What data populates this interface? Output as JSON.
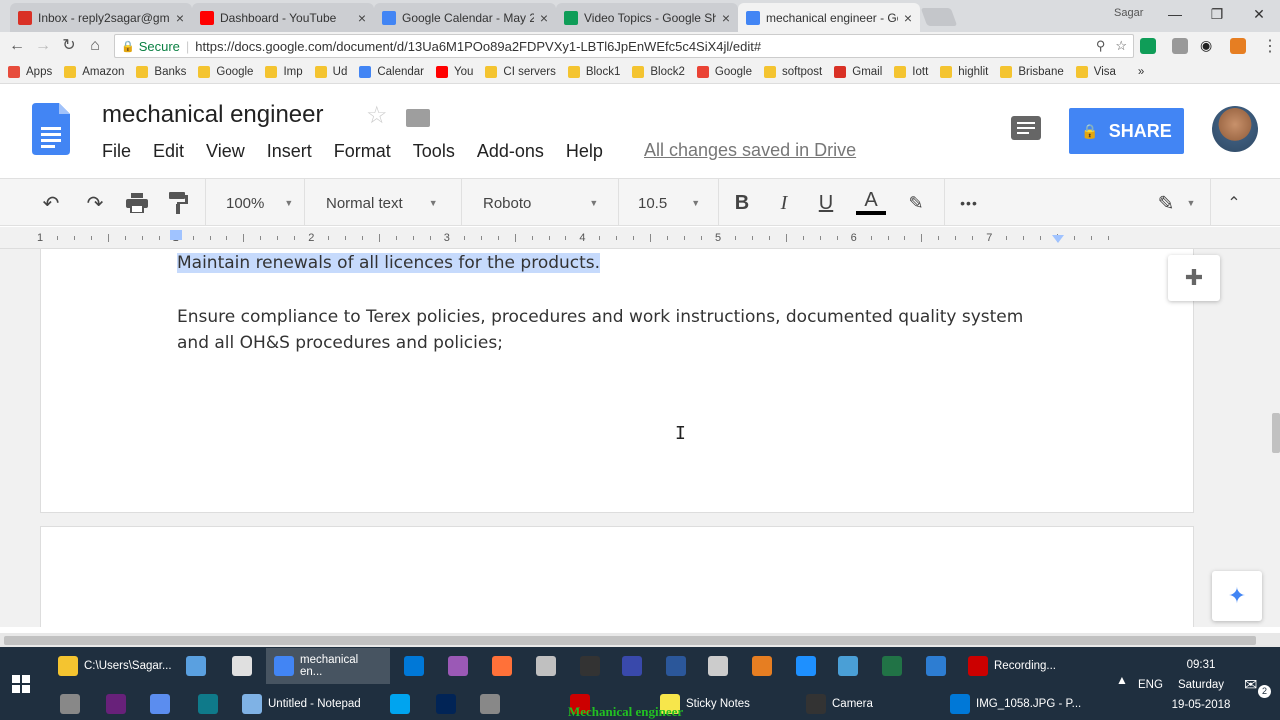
{
  "browser": {
    "tabs": [
      {
        "title": "Inbox - reply2sagar@gm",
        "icon": "gmail-icon",
        "color": "#d93025"
      },
      {
        "title": "Dashboard - YouTube",
        "icon": "youtube-icon",
        "color": "#ff0000"
      },
      {
        "title": "Google Calendar - May 2",
        "icon": "calendar-icon",
        "color": "#4285f4"
      },
      {
        "title": "Video Topics - Google Sh",
        "icon": "sheets-icon",
        "color": "#0f9d58"
      },
      {
        "title": "mechanical engineer - Go",
        "icon": "docs-icon",
        "color": "#4285f4"
      }
    ],
    "user": "Sagar",
    "secure_label": "Secure",
    "url": "https://docs.google.com/document/d/13Ua6M1POo89a2FDPVXy1-LBTl6JpEnWEfc5c4SiX4jl/edit#",
    "bookmarks": [
      {
        "label": "Apps",
        "color": "#e74c3c"
      },
      {
        "label": "Amazon",
        "color": "#f4c430"
      },
      {
        "label": "Banks",
        "color": "#f4c430"
      },
      {
        "label": "Google",
        "color": "#f4c430"
      },
      {
        "label": "Imp",
        "color": "#f4c430"
      },
      {
        "label": "Ud",
        "color": "#f4c430"
      },
      {
        "label": "Calendar",
        "color": "#4285f4"
      },
      {
        "label": "You",
        "color": "#ff0000"
      },
      {
        "label": "CI servers",
        "color": "#f4c430"
      },
      {
        "label": "Block1",
        "color": "#f4c430"
      },
      {
        "label": "Block2",
        "color": "#f4c430"
      },
      {
        "label": "Google",
        "color": "#ea4335"
      },
      {
        "label": "softpost",
        "color": "#f4c430"
      },
      {
        "label": "Gmail",
        "color": "#d93025"
      },
      {
        "label": "Iott",
        "color": "#f4c430"
      },
      {
        "label": "highlit",
        "color": "#f4c430"
      },
      {
        "label": "Brisbane",
        "color": "#f4c430"
      },
      {
        "label": "Visa",
        "color": "#f4c430"
      }
    ]
  },
  "doc": {
    "title": "mechanical engineer",
    "menu": [
      "File",
      "Edit",
      "View",
      "Insert",
      "Format",
      "Tools",
      "Add-ons",
      "Help"
    ],
    "save_status": "All changes saved in Drive",
    "share_label": "SHARE",
    "accent": "#4285f4"
  },
  "toolbar": {
    "zoom": "100%",
    "style": "Normal text",
    "font": "Roboto",
    "size": "10.5",
    "more": "•••"
  },
  "ruler": {
    "numbers": [
      "1",
      "1",
      "2",
      "3",
      "4",
      "5",
      "6",
      "7"
    ]
  },
  "content": {
    "line1": "Maintain renewals of all licences for the products.",
    "line2": "Ensure compliance to Terex policies, procedures and work instructions, documented quality system",
    "line3": "and all OH&S procedures and policies;"
  },
  "taskbar": {
    "row1": [
      {
        "label": "C:\\Users\\Sagar...",
        "color": "#f4c430"
      },
      {
        "label": "",
        "color": "#5aa0e0"
      },
      {
        "label": "",
        "color": "#e0e0e0"
      },
      {
        "label": "mechanical en...",
        "color": "#4285f4"
      },
      {
        "label": "",
        "color": "#0078d7"
      },
      {
        "label": "",
        "color": "#9b59b6"
      },
      {
        "label": "",
        "color": "#ff7139"
      },
      {
        "label": "",
        "color": "#c0c0c0"
      },
      {
        "label": "",
        "color": "#333333"
      },
      {
        "label": "",
        "color": "#3949ab"
      },
      {
        "label": "",
        "color": "#2b579a"
      },
      {
        "label": "",
        "color": "#cccccc"
      },
      {
        "label": "",
        "color": "#e67e22"
      },
      {
        "label": "",
        "color": "#1e90ff"
      },
      {
        "label": "",
        "color": "#4a9fd6"
      },
      {
        "label": "",
        "color": "#217346"
      },
      {
        "label": "",
        "color": "#2d7dd2"
      },
      {
        "label": "Recording...",
        "color": "#cc0000"
      }
    ],
    "row2": [
      {
        "label": "",
        "color": "#888888"
      },
      {
        "label": "",
        "color": "#68217a"
      },
      {
        "label": "",
        "color": "#5b8def"
      },
      {
        "label": "",
        "color": "#0f7a8a"
      },
      {
        "label": "Untitled - Notepad",
        "color": "#7fb2e5"
      },
      {
        "label": "",
        "color": "#00a4ef"
      },
      {
        "label": "",
        "color": "#012456"
      },
      {
        "label": "",
        "color": "#888888"
      },
      {
        "label": "",
        "color": "#cc0000"
      },
      {
        "label": "Sticky Notes",
        "color": "#f7e64b"
      },
      {
        "label": "Camera",
        "color": "#333333"
      },
      {
        "label": "IMG_1058.JPG - P...",
        "color": "#0078d7"
      }
    ],
    "lang": "ENG",
    "time": "09:31",
    "day": "Saturday",
    "date": "19-05-2018",
    "notif_count": "2",
    "overlay_title": "Mechanical engineer"
  }
}
